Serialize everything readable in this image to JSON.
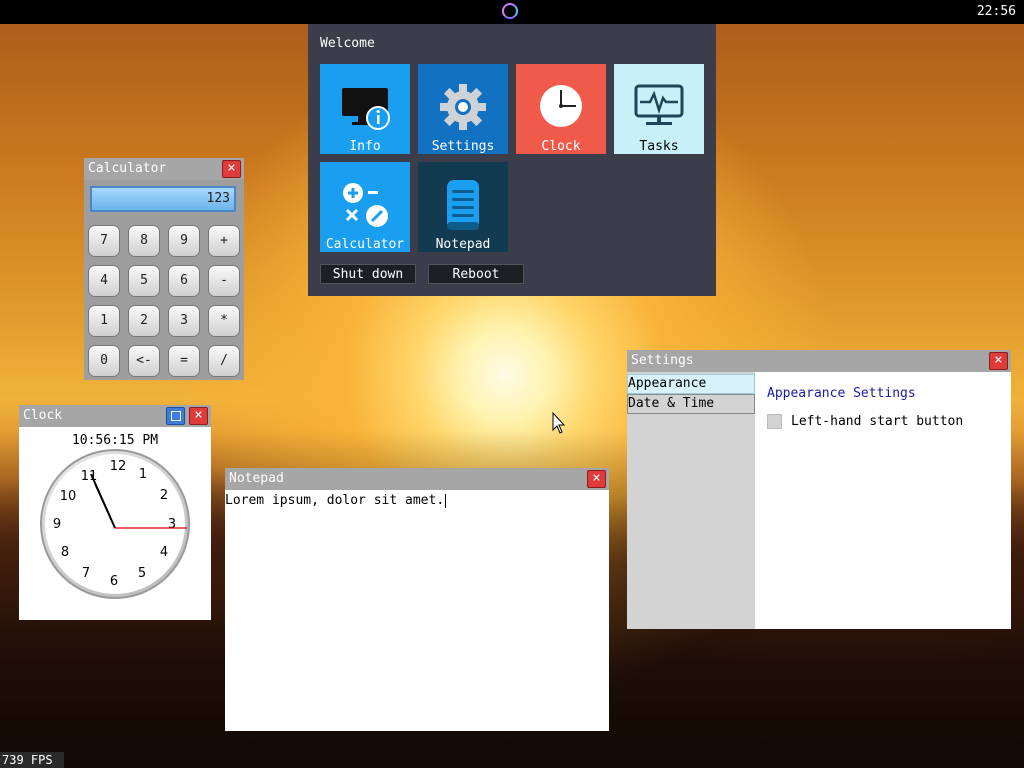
{
  "topbar": {
    "time": "22:56"
  },
  "start_menu": {
    "title": "Welcome",
    "tiles": [
      {
        "label": "Info",
        "color": "#1a9ef0"
      },
      {
        "label": "Settings",
        "color": "#1271c0"
      },
      {
        "label": "Clock",
        "color": "#f05a4a"
      },
      {
        "label": "Tasks",
        "color": "#c8f0f8"
      },
      {
        "label": "Calculator",
        "color": "#1a9ef0"
      },
      {
        "label": "Notepad",
        "color": "#123a50"
      }
    ],
    "shutdown_label": "Shut down",
    "reboot_label": "Reboot"
  },
  "calculator": {
    "title": "Calculator",
    "display": "123",
    "keys": [
      "7",
      "8",
      "9",
      "+",
      "4",
      "5",
      "6",
      "-",
      "1",
      "2",
      "3",
      "*",
      "0",
      "<-",
      "=",
      "/"
    ]
  },
  "clock_window": {
    "title": "Clock",
    "digital_time": "10:56:15 PM",
    "numbers": [
      "12",
      "1",
      "2",
      "3",
      "4",
      "5",
      "6",
      "7",
      "8",
      "9",
      "10",
      "11"
    ]
  },
  "notepad": {
    "title": "Notepad",
    "text": "Lorem ipsum, dolor sit amet."
  },
  "settings": {
    "title": "Settings",
    "sidebar": [
      "Appearance",
      "Date & Time"
    ],
    "heading": "Appearance Settings",
    "checkbox_label": "Left-hand start button"
  },
  "fps": "739 FPS",
  "close_glyph": "×"
}
